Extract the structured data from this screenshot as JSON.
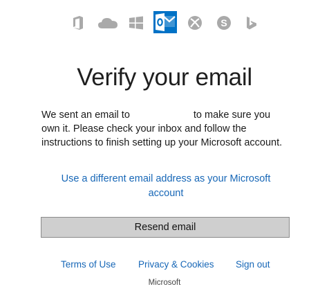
{
  "product_icons": [
    {
      "name": "office-icon",
      "active": false
    },
    {
      "name": "onedrive-icon",
      "active": false
    },
    {
      "name": "windows-icon",
      "active": false
    },
    {
      "name": "outlook-icon",
      "active": true
    },
    {
      "name": "xbox-icon",
      "active": false
    },
    {
      "name": "skype-icon",
      "active": false
    },
    {
      "name": "bing-icon",
      "active": false
    }
  ],
  "colors": {
    "icon_inactive": "#a9a9a9",
    "outlook_blue": "#0072c6",
    "link": "#1767b7",
    "button_bg": "#cfcfcf"
  },
  "title": "Verify your email",
  "message": {
    "prefix": "We sent an email to",
    "suffix": "to make sure you own it. Please check your inbox and follow the instructions to finish setting up your Microsoft account."
  },
  "alt_link": "Use a different email address as your Microsoft account",
  "resend_button": "Resend email",
  "footer": {
    "terms": "Terms of Use",
    "privacy": "Privacy & Cookies",
    "signout": "Sign out",
    "brand": "Microsoft"
  }
}
